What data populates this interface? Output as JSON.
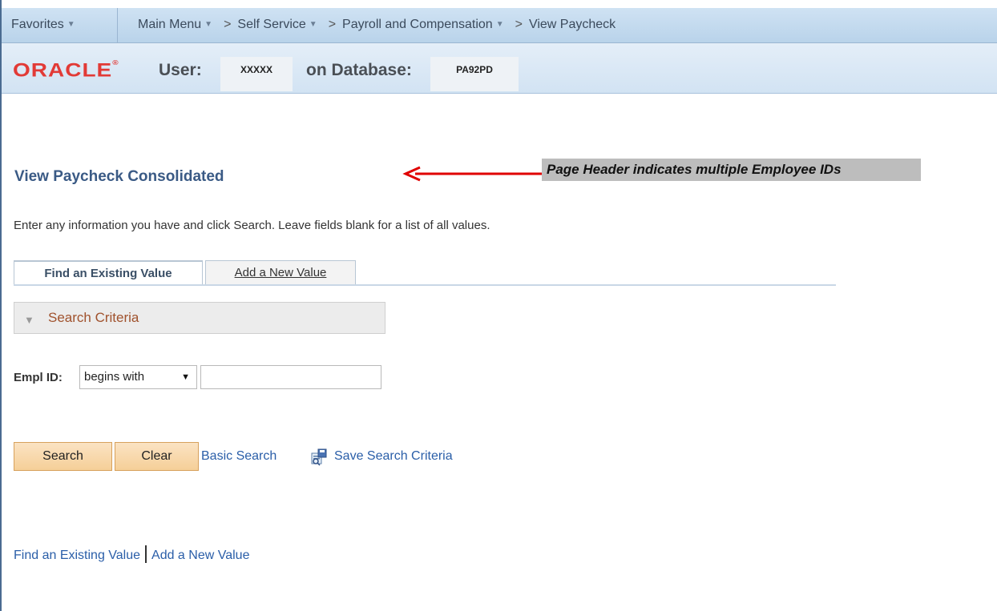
{
  "navbar": {
    "favorites": "Favorites",
    "main_menu": "Main Menu",
    "breadcrumb": [
      "Self Service",
      "Payroll and Compensation",
      "View Paycheck"
    ]
  },
  "header": {
    "logo_text": "ORACLE",
    "user_label": "User:",
    "user_value": "XXXXX",
    "db_label": "on Database:",
    "db_value": "PA92PD"
  },
  "page": {
    "title": "View Paycheck Consolidated",
    "callout": "Page Header indicates multiple Employee IDs",
    "instructions": "Enter any information you have and click Search. Leave fields blank for a list of all values."
  },
  "tabs": [
    "Find an Existing Value",
    "Add a New Value"
  ],
  "search_criteria": {
    "section_label": "Search Criteria",
    "empl_id_label": "Empl ID:",
    "operator_selected": "begins with",
    "empl_id_value": ""
  },
  "actions": {
    "search": "Search",
    "clear": "Clear",
    "basic_search": "Basic Search",
    "save_criteria": "Save Search Criteria"
  },
  "bottom_links": [
    "Find an Existing Value",
    "Add a New Value"
  ],
  "colors": {
    "oracle_red": "#e23a36",
    "link_blue": "#2a5ea8",
    "button_orange": "#f5cf98",
    "callout_gray": "#bdbdbd",
    "arrow_red": "#e00000"
  }
}
